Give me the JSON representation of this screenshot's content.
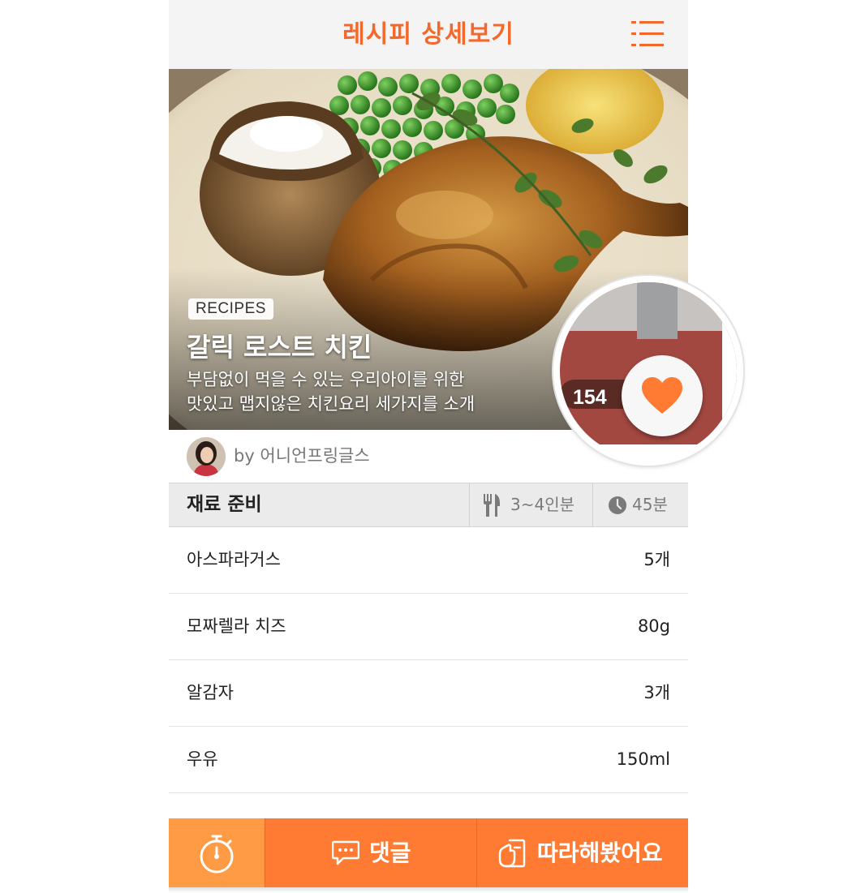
{
  "header": {
    "title": "레시피 상세보기",
    "menu_icon": "list-menu-icon",
    "accent_color": "#f4682b"
  },
  "hero": {
    "tag": "RECIPES",
    "title": "갈릭 로스트 치킨",
    "description_line1": "부담없이 먹을 수 있는 우리아이를 위한",
    "description_line2": "맛있고 맵지않은 치킨요리 세가지를 소개"
  },
  "like": {
    "count": "154",
    "icon": "heart-icon",
    "color": "#ff7b33"
  },
  "author": {
    "label": "by 어니언프링글스"
  },
  "ingredients_section": {
    "title": "재료 준비",
    "serving_icon": "fork-knife-icon",
    "serving": "3~4인분",
    "time_icon": "clock-icon",
    "time": "45분"
  },
  "ingredients": [
    {
      "name": "아스파라거스",
      "qty": "5개"
    },
    {
      "name": "모짜렐라 치즈",
      "qty": "80g"
    },
    {
      "name": "알감자",
      "qty": "3개"
    },
    {
      "name": "우유",
      "qty": "150ml"
    }
  ],
  "toolbar": {
    "timer_icon": "stopwatch-icon",
    "comment_icon": "speech-bubble-icon",
    "comment_label": "댓글",
    "follow_icon": "hand-note-icon",
    "follow_label": "따라해봤어요",
    "bar_color": "#ff7b33"
  }
}
